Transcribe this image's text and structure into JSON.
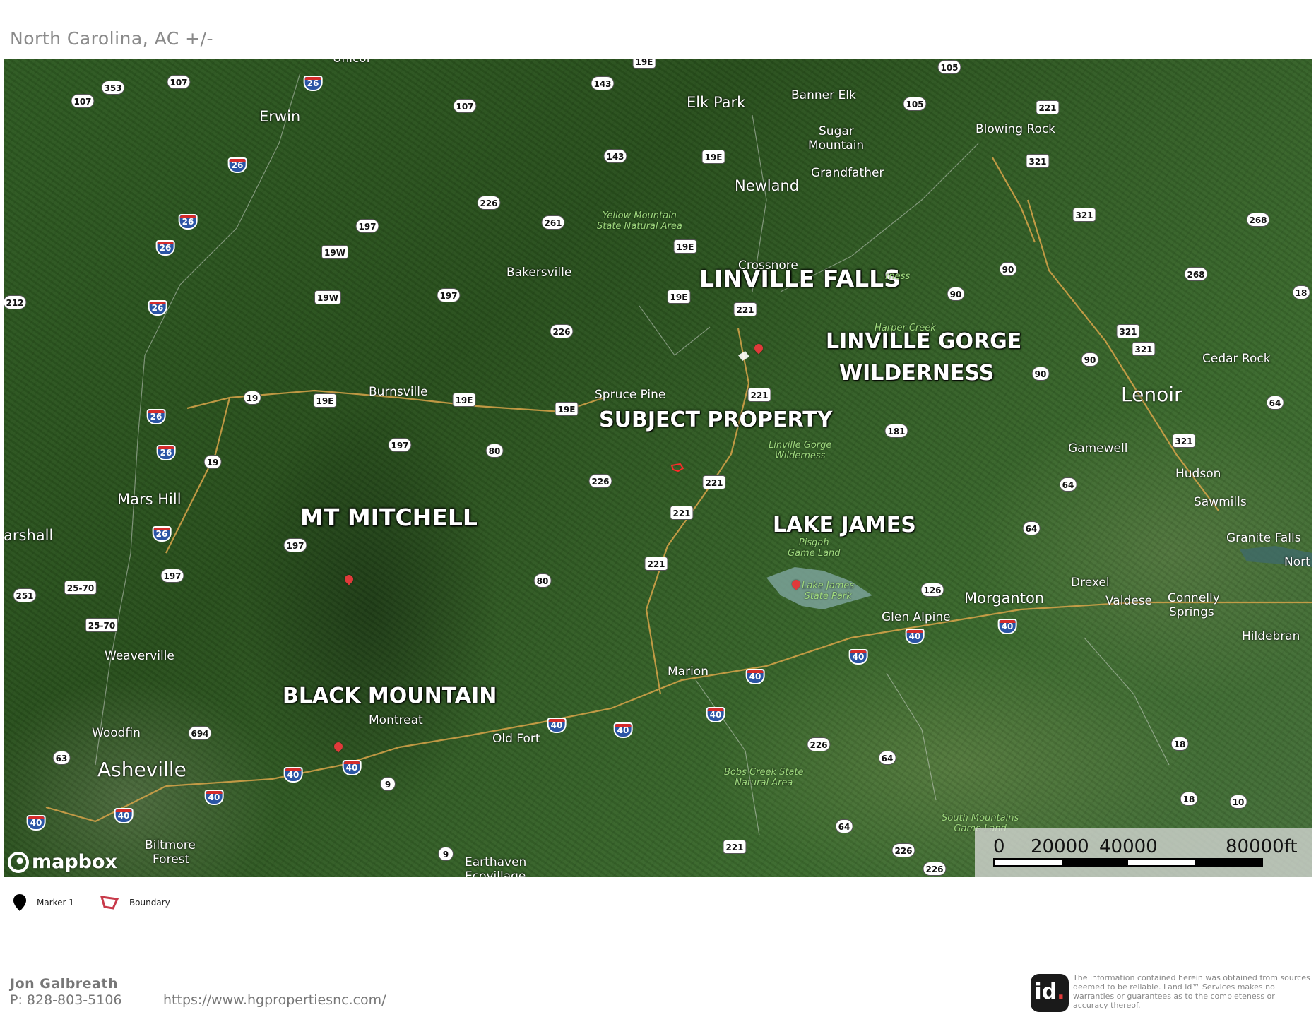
{
  "header": {
    "title": "North Carolina,  AC +/-"
  },
  "map": {
    "big_labels": {
      "linville_falls": "LINVILLE FALLS",
      "linville_gorge_1": "LINVILLE GORGE",
      "linville_gorge_2": "WILDERNESS",
      "subject_property": "SUBJECT PROPERTY",
      "mt_mitchell": "MT MITCHELL",
      "lake_james": "LAKE JAMES",
      "black_mountain": "BLACK MOUNTAIN"
    },
    "places": {
      "elk_park": "Elk Park",
      "banner_elk": "Banner Elk",
      "sugar_mountain_1": "Sugar",
      "sugar_mountain_2": "Mountain",
      "blowing_rock": "Blowing Rock",
      "grandfather": "Grandfather",
      "newland": "Newland",
      "erwin": "Erwin",
      "unicoi": "Unicoi",
      "bakersville": "Bakersville",
      "crossnore": "Crossnore",
      "spruce_pine": "Spruce Pine",
      "burnsville": "Burnsville",
      "lenoir": "Lenoir",
      "cedar_rock": "Cedar Rock",
      "gamewell": "Gamewell",
      "hudson": "Hudson",
      "sawmills": "Sawmills",
      "granite_falls": "Granite Falls",
      "mars_hill": "Mars Hill",
      "marshall": "arshall",
      "drexel": "Drexel",
      "morganton": "Morganton",
      "valdese": "Valdese",
      "connelly_1": "Connelly",
      "connelly_2": "Springs",
      "glen_alpine": "Glen Alpine",
      "hildebran": "Hildebran",
      "weaverville": "Weaverville",
      "marion": "Marion",
      "montreat": "Montreat",
      "woodfin": "Woodfin",
      "old_fort": "Old Fort",
      "asheville": "Asheville",
      "biltmore_1": "Biltmore",
      "biltmore_2": "Forest",
      "earthaven_1": "Earthaven",
      "earthaven_2": "Ecovillage",
      "north": "Nort"
    },
    "parks": {
      "yellow_mountain": "Yellow Mountain\nState Natural Area",
      "linville_wilderness": "Linville Gorge\nWilderness",
      "harper_creek": "Harper Creek",
      "pisgah": "Pisgah\nGame Land",
      "lake_james_park": "Lake James\nState Park",
      "bobs_creek": "Bobs Creek State\nNatural Area",
      "south_mountains": "South Mountains\nGame Land",
      "wilderness_fragment": "rness"
    },
    "shields": [
      {
        "id": "s1",
        "label": "353",
        "kind": "state"
      },
      {
        "id": "s2",
        "label": "107",
        "kind": "state"
      },
      {
        "id": "s3",
        "label": "107",
        "kind": "state"
      },
      {
        "id": "s4",
        "label": "26",
        "kind": "interstate"
      },
      {
        "id": "s5",
        "label": "107",
        "kind": "state"
      },
      {
        "id": "s6",
        "label": "143",
        "kind": "state"
      },
      {
        "id": "s7",
        "label": "105",
        "kind": "state"
      },
      {
        "id": "s8",
        "label": "105",
        "kind": "state"
      },
      {
        "id": "s9",
        "label": "221",
        "kind": "us"
      },
      {
        "id": "s10",
        "label": "26",
        "kind": "interstate"
      },
      {
        "id": "s11",
        "label": "143",
        "kind": "state"
      },
      {
        "id": "s12",
        "label": "19E",
        "kind": "us"
      },
      {
        "id": "s13",
        "label": "321",
        "kind": "us"
      },
      {
        "id": "s14",
        "label": "226",
        "kind": "state"
      },
      {
        "id": "s15",
        "label": "26",
        "kind": "interstate"
      },
      {
        "id": "s16",
        "label": "197",
        "kind": "state"
      },
      {
        "id": "s17",
        "label": "261",
        "kind": "state"
      },
      {
        "id": "s18",
        "label": "321",
        "kind": "us"
      },
      {
        "id": "s19",
        "label": "268",
        "kind": "state"
      },
      {
        "id": "s20",
        "label": "26",
        "kind": "interstate"
      },
      {
        "id": "s21",
        "label": "19W",
        "kind": "us"
      },
      {
        "id": "s22",
        "label": "19E",
        "kind": "us"
      },
      {
        "id": "s23",
        "label": "90",
        "kind": "state"
      },
      {
        "id": "s24",
        "label": "268",
        "kind": "state"
      },
      {
        "id": "s25",
        "label": "212",
        "kind": "state"
      },
      {
        "id": "s26",
        "label": "19W",
        "kind": "us"
      },
      {
        "id": "s27",
        "label": "197",
        "kind": "state"
      },
      {
        "id": "s28",
        "label": "19E",
        "kind": "us"
      },
      {
        "id": "s29",
        "label": "90",
        "kind": "state"
      },
      {
        "id": "s30",
        "label": "18",
        "kind": "state"
      },
      {
        "id": "s31",
        "label": "26",
        "kind": "interstate"
      },
      {
        "id": "s32",
        "label": "221",
        "kind": "us"
      },
      {
        "id": "s33",
        "label": "226",
        "kind": "state"
      },
      {
        "id": "s34",
        "label": "321",
        "kind": "us"
      },
      {
        "id": "s35",
        "label": "321",
        "kind": "us"
      },
      {
        "id": "s36",
        "label": "90",
        "kind": "state"
      },
      {
        "id": "s37",
        "label": "90",
        "kind": "state"
      },
      {
        "id": "s38",
        "label": "19",
        "kind": "state"
      },
      {
        "id": "s39",
        "label": "19E",
        "kind": "us"
      },
      {
        "id": "s40",
        "label": "19E",
        "kind": "us"
      },
      {
        "id": "s41",
        "label": "19E",
        "kind": "us"
      },
      {
        "id": "s42",
        "label": "221",
        "kind": "us"
      },
      {
        "id": "s43",
        "label": "26",
        "kind": "interstate"
      },
      {
        "id": "s44",
        "label": "64",
        "kind": "state"
      },
      {
        "id": "s45",
        "label": "181",
        "kind": "state"
      },
      {
        "id": "s46",
        "label": "197",
        "kind": "state"
      },
      {
        "id": "s47",
        "label": "80",
        "kind": "state"
      },
      {
        "id": "s48",
        "label": "321",
        "kind": "us"
      },
      {
        "id": "s49",
        "label": "26",
        "kind": "interstate"
      },
      {
        "id": "s50",
        "label": "19",
        "kind": "state"
      },
      {
        "id": "s51",
        "label": "226",
        "kind": "state"
      },
      {
        "id": "s52",
        "label": "221",
        "kind": "us"
      },
      {
        "id": "s53",
        "label": "64",
        "kind": "state"
      },
      {
        "id": "s54",
        "label": "221",
        "kind": "us"
      },
      {
        "id": "s55",
        "label": "26",
        "kind": "interstate"
      },
      {
        "id": "s56",
        "label": "64",
        "kind": "state"
      },
      {
        "id": "s57",
        "label": "197",
        "kind": "state"
      },
      {
        "id": "s58",
        "label": "221",
        "kind": "us"
      },
      {
        "id": "s59",
        "label": "197",
        "kind": "state"
      },
      {
        "id": "s60",
        "label": "80",
        "kind": "state"
      },
      {
        "id": "s61",
        "label": "25-70",
        "kind": "us"
      },
      {
        "id": "s62",
        "label": "251",
        "kind": "state"
      },
      {
        "id": "s63",
        "label": "126",
        "kind": "state"
      },
      {
        "id": "s64",
        "label": "25-70",
        "kind": "us"
      },
      {
        "id": "s65",
        "label": "40",
        "kind": "interstate"
      },
      {
        "id": "s66",
        "label": "40",
        "kind": "interstate"
      },
      {
        "id": "s67",
        "label": "40",
        "kind": "interstate"
      },
      {
        "id": "s68",
        "label": "40",
        "kind": "interstate"
      },
      {
        "id": "s69",
        "label": "40",
        "kind": "interstate"
      },
      {
        "id": "s70",
        "label": "40",
        "kind": "interstate"
      },
      {
        "id": "s71",
        "label": "694",
        "kind": "state"
      },
      {
        "id": "s72",
        "label": "40",
        "kind": "interstate"
      },
      {
        "id": "s73",
        "label": "226",
        "kind": "state"
      },
      {
        "id": "s74",
        "label": "18",
        "kind": "state"
      },
      {
        "id": "s75",
        "label": "63",
        "kind": "state"
      },
      {
        "id": "s76",
        "label": "64",
        "kind": "state"
      },
      {
        "id": "s77",
        "label": "40",
        "kind": "interstate"
      },
      {
        "id": "s78",
        "label": "40",
        "kind": "interstate"
      },
      {
        "id": "s79",
        "label": "9",
        "kind": "state"
      },
      {
        "id": "s80",
        "label": "40",
        "kind": "interstate"
      },
      {
        "id": "s81",
        "label": "40",
        "kind": "interstate"
      },
      {
        "id": "s82",
        "label": "40",
        "kind": "interstate"
      },
      {
        "id": "s83",
        "label": "18",
        "kind": "state"
      },
      {
        "id": "s84",
        "label": "10",
        "kind": "state"
      },
      {
        "id": "s85",
        "label": "64",
        "kind": "state"
      },
      {
        "id": "s86",
        "label": "221",
        "kind": "us"
      },
      {
        "id": "s87",
        "label": "226",
        "kind": "state"
      },
      {
        "id": "s88",
        "label": "226",
        "kind": "state"
      },
      {
        "id": "s89",
        "label": "9",
        "kind": "state"
      },
      {
        "id": "s90",
        "label": "19E",
        "kind": "us"
      }
    ],
    "attribution": "mapbox",
    "scale": {
      "labels": [
        "0",
        "20000",
        "40000",
        "80000ft"
      ]
    }
  },
  "legend": {
    "marker_label": "Marker 1",
    "boundary_label": "Boundary"
  },
  "footer": {
    "name": "Jon  Galbreath",
    "phone": "P: 828-803-5106",
    "url": "https://www.hgpropertiesnc.com/",
    "logo_text": "id",
    "disclaimer": "The information contained herein was obtained from sources deemed to be reliable. Land id™ Services makes no warranties or guarantees as to the completeness or accuracy thereof."
  },
  "colors": {
    "marker": "#e03a3a",
    "interstate": "#2b55a5",
    "road": "#d9a54a"
  }
}
